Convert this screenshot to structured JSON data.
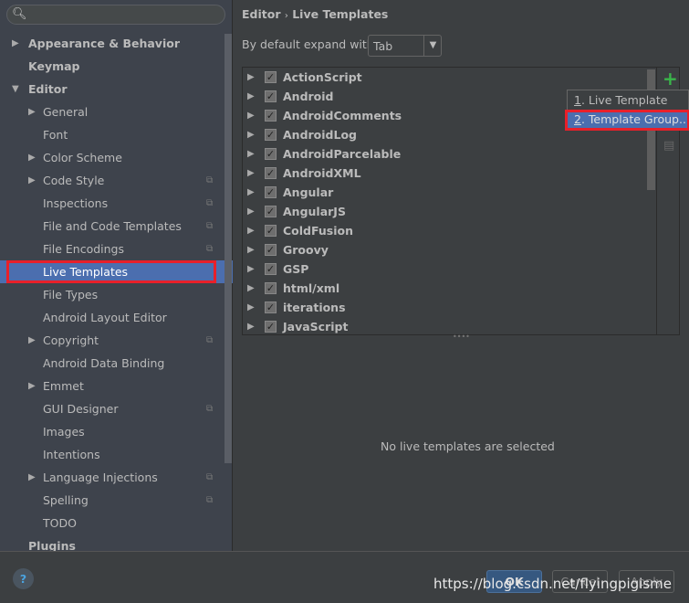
{
  "search": {
    "placeholder": ""
  },
  "sidebar": {
    "items": [
      {
        "label": "Appearance & Behavior",
        "level": 0,
        "arrow": "right",
        "bold": true
      },
      {
        "label": "Keymap",
        "level": 0,
        "bold": true
      },
      {
        "label": "Editor",
        "level": 0,
        "arrow": "down",
        "bold": true
      },
      {
        "label": "General",
        "level": 1,
        "arrow": "right"
      },
      {
        "label": "Font",
        "level": 1
      },
      {
        "label": "Color Scheme",
        "level": 1,
        "arrow": "right"
      },
      {
        "label": "Code Style",
        "level": 1,
        "arrow": "right",
        "copy": true
      },
      {
        "label": "Inspections",
        "level": 1,
        "copy": true
      },
      {
        "label": "File and Code Templates",
        "level": 1,
        "copy": true
      },
      {
        "label": "File Encodings",
        "level": 1,
        "copy": true
      },
      {
        "label": "Live Templates",
        "level": 1,
        "selected": true
      },
      {
        "label": "File Types",
        "level": 1
      },
      {
        "label": "Android Layout Editor",
        "level": 1
      },
      {
        "label": "Copyright",
        "level": 1,
        "arrow": "right",
        "copy": true
      },
      {
        "label": "Android Data Binding",
        "level": 1
      },
      {
        "label": "Emmet",
        "level": 1,
        "arrow": "right"
      },
      {
        "label": "GUI Designer",
        "level": 1,
        "copy": true
      },
      {
        "label": "Images",
        "level": 1
      },
      {
        "label": "Intentions",
        "level": 1
      },
      {
        "label": "Language Injections",
        "level": 1,
        "arrow": "right",
        "copy": true
      },
      {
        "label": "Spelling",
        "level": 1,
        "copy": true
      },
      {
        "label": "TODO",
        "level": 1
      },
      {
        "label": "Plugins",
        "level": 0,
        "bold": true
      }
    ]
  },
  "breadcrumb": {
    "parent": "Editor",
    "sep": "›",
    "current": "Live Templates"
  },
  "expand": {
    "label": "By default expand with",
    "value": "Tab"
  },
  "templates": [
    "ActionScript",
    "Android",
    "AndroidComments",
    "AndroidLog",
    "AndroidParcelable",
    "AndroidXML",
    "Angular",
    "AngularJS",
    "ColdFusion",
    "Groovy",
    "GSP",
    "html/xml",
    "iterations",
    "JavaScript"
  ],
  "popup": {
    "items": [
      {
        "num": "1",
        "label": ". Live Template"
      },
      {
        "num": "2",
        "label": ". Template Group..."
      }
    ]
  },
  "empty_text": "No live templates are selected",
  "buttons": {
    "help": "?",
    "ok": "OK",
    "cancel": "Cancel",
    "apply": "Apply"
  },
  "watermark": "https://blog.csdn.net/flyingpigisme",
  "colors": {
    "selection": "#4b6eaf",
    "highlight_box": "#e8202a",
    "add": "#3ab54a"
  }
}
